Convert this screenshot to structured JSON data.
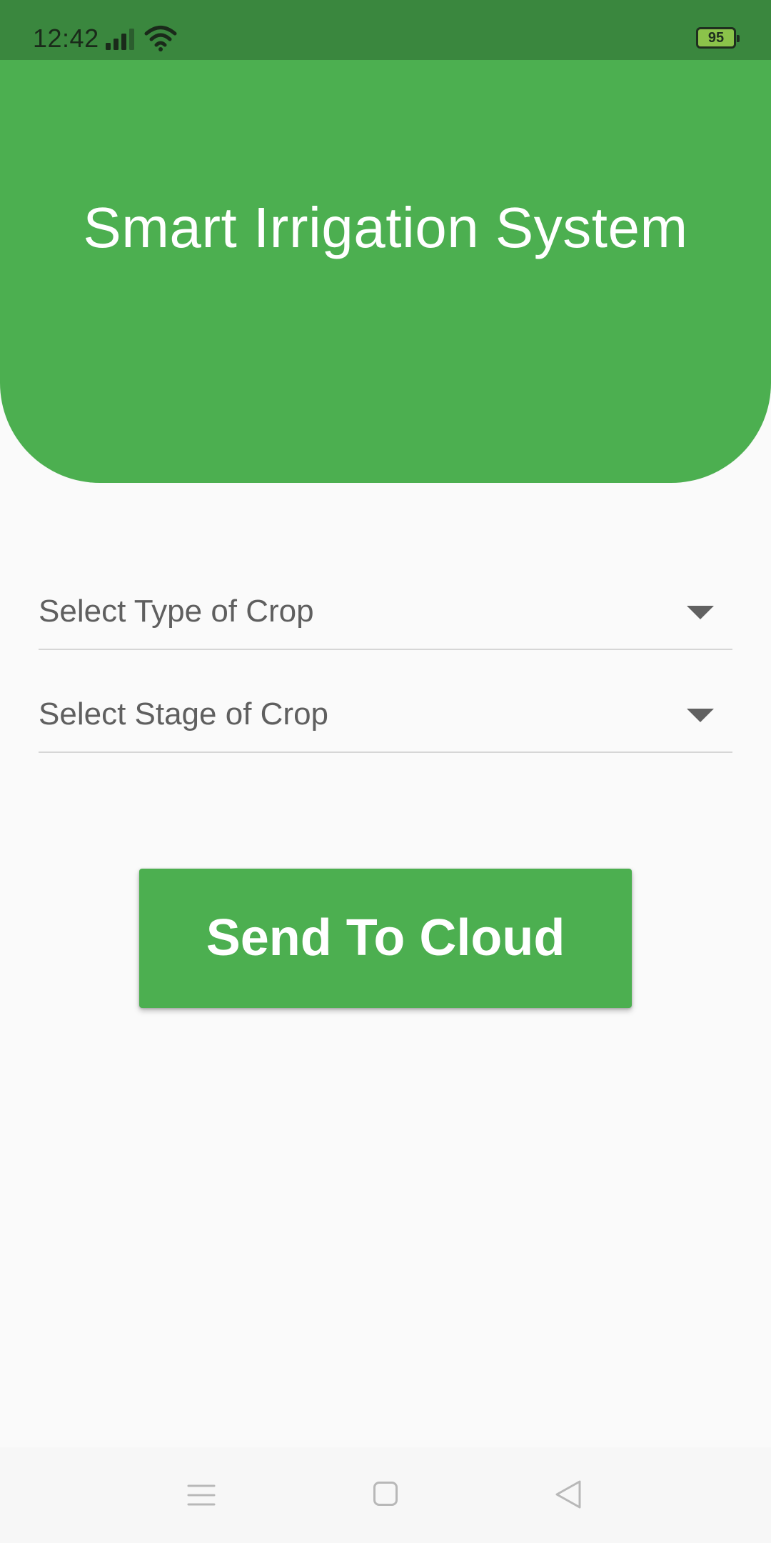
{
  "status_bar": {
    "time": "12:42",
    "battery_level": "95",
    "signal_icon": "signal-bars-icon",
    "wifi_icon": "wifi-icon"
  },
  "header": {
    "title": "Smart Irrigation System",
    "color": "#4caf50"
  },
  "form": {
    "crop_type_placeholder": "Select Type of Crop",
    "crop_stage_placeholder": "Select Stage of Crop",
    "dropdown_icon": "dropdown-arrow-icon"
  },
  "actions": {
    "send_label": "Send To Cloud"
  },
  "nav_bar": {
    "menu_icon": "menu-icon",
    "home_icon": "home-icon",
    "back_icon": "back-icon"
  },
  "colors": {
    "status_bar": "#3a873e",
    "accent": "#4caf50",
    "background": "#fafafa",
    "text_secondary": "#5f5f5f"
  }
}
